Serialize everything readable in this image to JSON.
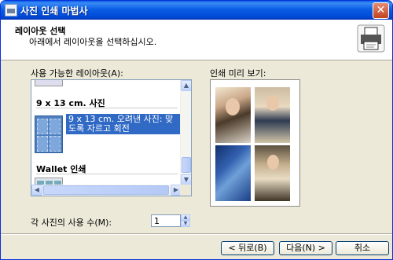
{
  "window": {
    "title": "사진 인쇄 마법사",
    "close_glyph": "✕"
  },
  "header": {
    "title": "레이아웃 선택",
    "subtitle": "아래에서 레이아웃을 선택하십시오."
  },
  "layouts": {
    "label": "사용 가능한 레이아웃(A):",
    "groups": [
      {
        "title": "9 x 13 cm. 사진"
      },
      {
        "title": "Wallet 인쇄"
      }
    ],
    "selected_item": "9 x 13 cm. 오려낸 사진: 맞도록 자르고 회전"
  },
  "preview": {
    "label": "인쇄 미리 보기:"
  },
  "copies": {
    "label": "각 사진의 사용 수(M):",
    "value": "1"
  },
  "buttons": {
    "back": "< 뒤로(B)",
    "next": "다음(N) >",
    "cancel": "취소"
  },
  "icons": {
    "app": "printer-wizard-icon",
    "header": "printer-icon",
    "scroll_up": "▲",
    "scroll_down": "▼",
    "scroll_left": "◀",
    "scroll_right": "▶"
  },
  "colors": {
    "title_bar": "#0a5ee6",
    "selection": "#316ac5",
    "dialog_bg": "#ece9d8"
  }
}
